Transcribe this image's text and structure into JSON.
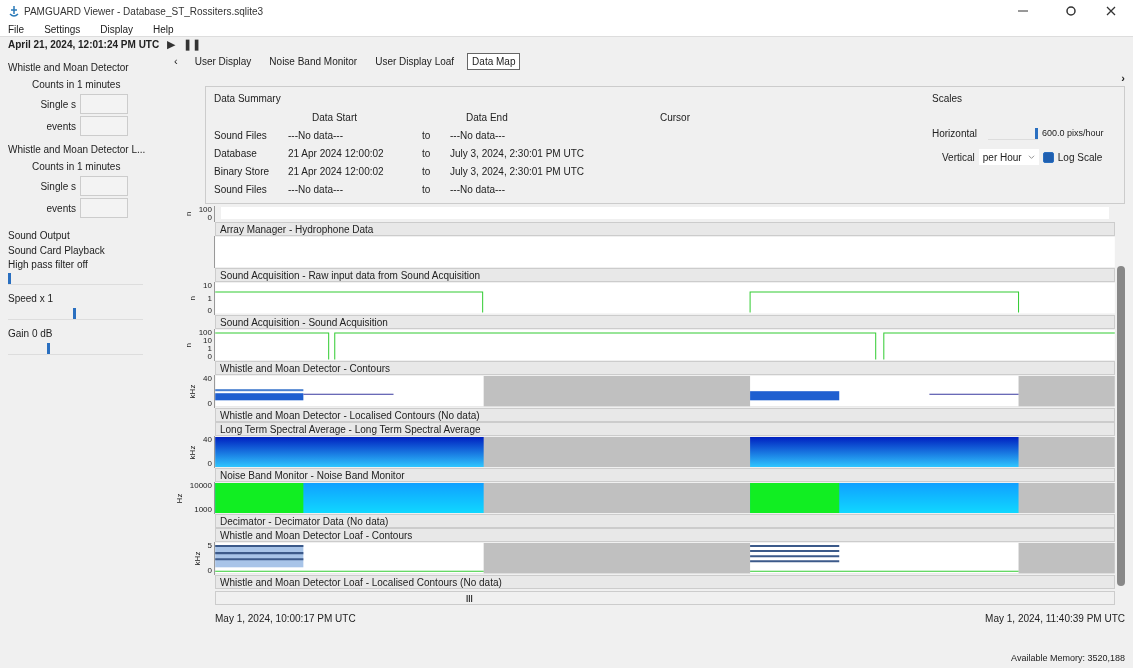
{
  "window": {
    "title": "PAMGUARD Viewer - Database_ST_Rossiters.sqlite3"
  },
  "menu": [
    "File",
    "Settings",
    "Display",
    "Help"
  ],
  "time": {
    "label": "April 21, 2024, 12:01:24 PM UTC",
    "play": "▶",
    "pause": "❚❚"
  },
  "sidebar": {
    "sections": [
      {
        "kind": "counts",
        "title": "Whistle and Moan Detector",
        "subtitle": "Counts in 1 minutes",
        "fields": [
          "Single s",
          "events"
        ]
      },
      {
        "kind": "counts",
        "title": "Whistle and Moan Detector L...",
        "subtitle": "Counts in 1 minutes",
        "fields": [
          "Single s",
          "events"
        ]
      },
      {
        "kind": "sound",
        "title": "Sound Output",
        "lines": [
          "Sound Card Playback",
          "High pass filter off"
        ],
        "sliders": [
          {
            "level": 0.0
          },
          {
            "label": "Speed x 1",
            "level": 0.5
          },
          {
            "label": "Gain 0 dB",
            "level": 0.3
          }
        ]
      }
    ]
  },
  "tabs": [
    {
      "label": "User Display",
      "selected": false
    },
    {
      "label": "Noise Band Monitor",
      "selected": false
    },
    {
      "label": "User Display Loaf",
      "selected": false
    },
    {
      "label": "Data Map",
      "selected": true
    }
  ],
  "tabs_scroll": "‹",
  "collapse": "›",
  "summary": {
    "title": "Data Summary",
    "columns": [
      "Data Start",
      "Data End",
      "Cursor"
    ],
    "rows": [
      {
        "name": "Sound Files",
        "start": "---No data---",
        "to": "to",
        "end": "---No data---"
      },
      {
        "name": "Database",
        "start": "21 Apr 2024 12:00:02",
        "to": "to",
        "end": "July 3, 2024, 2:30:01 PM UTC"
      },
      {
        "name": "Binary Store",
        "start": "21 Apr 2024 12:00:02",
        "to": "to",
        "end": "July 3, 2024, 2:30:01 PM UTC"
      },
      {
        "name": "Sound Files",
        "start": "---No data---",
        "to": "to",
        "end": "---No data---"
      }
    ]
  },
  "scales": {
    "title": "Scales",
    "horizontal_label": "Horizontal",
    "horizontal_slider": {
      "level": 1.0
    },
    "horizontal_value": "600.0 pixs/hour",
    "vertical_label": "Vertical",
    "vertical_value": "per Hour",
    "log_scale": {
      "label": "Log Scale",
      "checked": true
    }
  },
  "data_map": [
    {
      "kind": "strip",
      "unit": "n",
      "ticks": [
        "100",
        "0"
      ]
    },
    {
      "kind": "blank",
      "title": "Array Manager - Hydrophone Data"
    },
    {
      "kind": "raw",
      "title": "Sound Acquisition - Raw input data from Sound Acquisition",
      "unit": "n",
      "ticks": [
        "10",
        "1",
        "0"
      ]
    },
    {
      "kind": "sound",
      "title": "Sound Acquisition - Sound Acquisition",
      "unit": "n",
      "ticks": [
        "100",
        "10",
        "1",
        "0"
      ]
    },
    {
      "kind": "contours",
      "title": "Whistle and Moan Detector - Contours",
      "unit": "kHz",
      "ticks": [
        "40",
        "0"
      ]
    },
    {
      "kind": "empty",
      "title": "Whistle and Moan Detector - Localised Contours  (No data)"
    },
    {
      "kind": "ltsa",
      "title": "Long Term Spectral Average - Long Term Spectral Average",
      "unit": "kHz",
      "ticks": [
        "40",
        "0"
      ]
    },
    {
      "kind": "bands",
      "title": "Noise Band Monitor - Noise Band Monitor",
      "unit": "Hz",
      "ticks": [
        "10000",
        "1000"
      ]
    },
    {
      "kind": "empty",
      "title": "Decimator - Decimator Data  (No data)"
    },
    {
      "kind": "loaf",
      "title": "Whistle and Moan Detector Loaf - Contours",
      "unit": "kHz",
      "ticks": [
        "5",
        "0"
      ]
    },
    {
      "kind": "empty",
      "title": "Whistle and Moan Detector Loaf - Localised Contours  (No data)"
    }
  ],
  "scrollbar_grip": "|||",
  "time_start": "May 1, 2024, 10:00:17 PM UTC",
  "time_end": "May 1, 2024, 11:40:39 PM UTC",
  "status": "Available Memory: 3520,188"
}
